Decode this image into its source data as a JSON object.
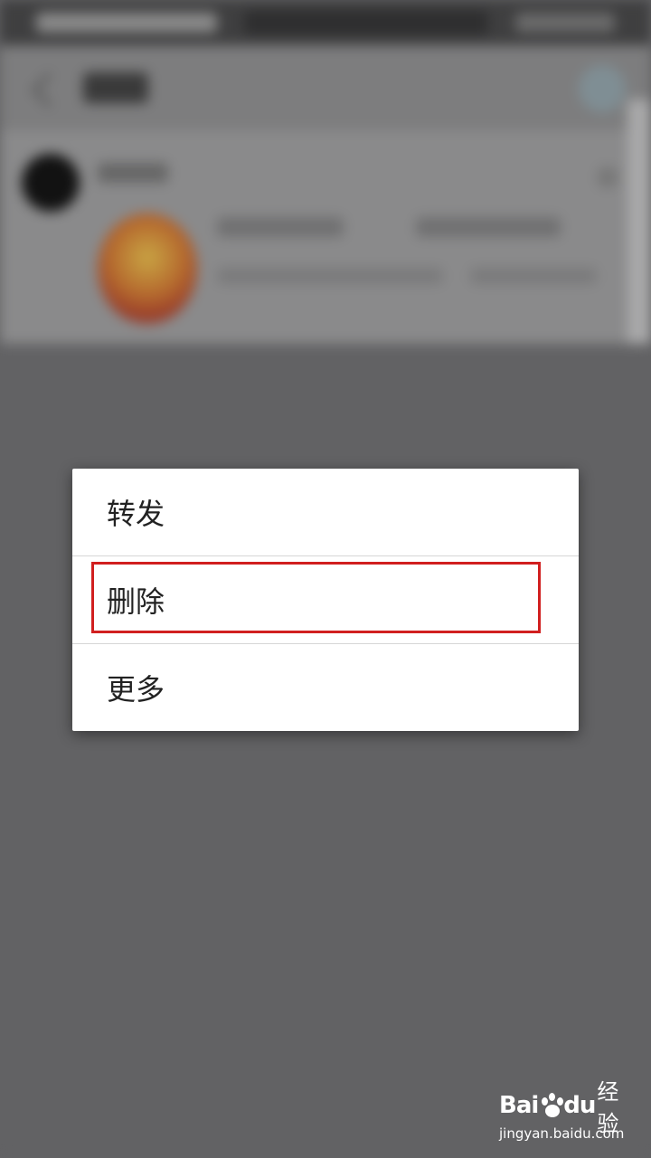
{
  "menu": {
    "items": [
      {
        "label": "转发"
      },
      {
        "label": "删除"
      },
      {
        "label": "更多"
      }
    ],
    "highlighted_item": "删除"
  },
  "watermark": {
    "brand_left": "Bai",
    "brand_right": "du",
    "service": "经验",
    "url": "jingyan.baidu.com"
  },
  "colors": {
    "overlay": "#626264",
    "dialog_bg": "#ffffff",
    "highlight": "#d11f1f",
    "text": "#222222"
  }
}
